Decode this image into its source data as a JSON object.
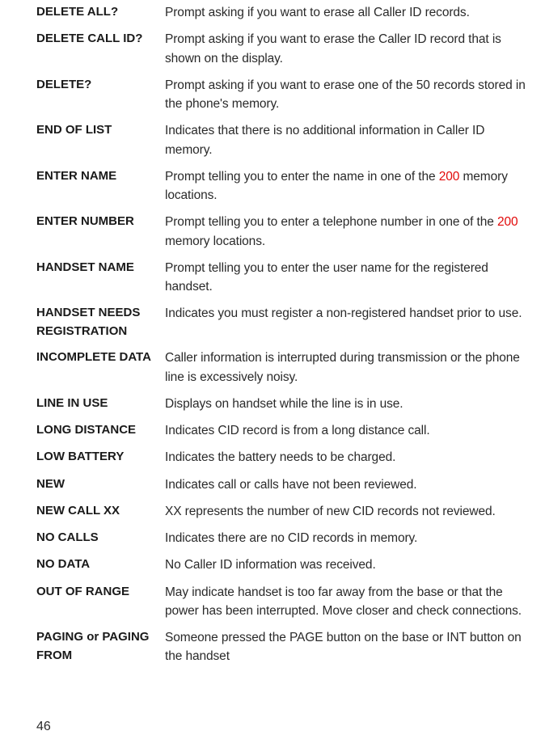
{
  "entries": [
    {
      "term": "DELETE ALL?",
      "parts": [
        {
          "text": "Prompt asking if you want to erase all Caller ID records."
        }
      ]
    },
    {
      "term": "DELETE CALL ID?",
      "parts": [
        {
          "text": "Prompt asking if you want to erase the Caller ID record that is shown on the display."
        }
      ]
    },
    {
      "term": "DELETE?",
      "parts": [
        {
          "text": "Prompt asking if you want to erase one of the 50 records stored in the phone's memory."
        }
      ]
    },
    {
      "term": "END OF LIST",
      "parts": [
        {
          "text": "Indicates that there is no additional information in Caller ID memory."
        }
      ]
    },
    {
      "term": "ENTER NAME",
      "parts": [
        {
          "text": "Prompt telling you to enter the name in one of the "
        },
        {
          "text": "200",
          "red": true
        },
        {
          "text": " memory locations."
        }
      ]
    },
    {
      "term": "ENTER NUMBER",
      "parts": [
        {
          "text": "Prompt telling you to enter a telephone number in one of the "
        },
        {
          "text": "200",
          "red": true
        },
        {
          "text": " memory locations."
        }
      ]
    },
    {
      "term": "HANDSET NAME",
      "parts": [
        {
          "text": "Prompt telling you to enter the user name for the registered handset."
        }
      ]
    },
    {
      "term": "HANDSET NEEDS REGISTRATION",
      "parts": [
        {
          "text": "Indicates you must register a non-registered handset prior to use."
        }
      ]
    },
    {
      "term": "INCOMPLETE DATA",
      "parts": [
        {
          "text": "Caller information is interrupted during transmission or the phone line is excessively noisy."
        }
      ]
    },
    {
      "term": "LINE IN USE",
      "parts": [
        {
          "text": "Displays on handset while the line is in use."
        }
      ]
    },
    {
      "term": "LONG DISTANCE",
      "parts": [
        {
          "text": "Indicates CID record is from a long distance call."
        }
      ]
    },
    {
      "term": "LOW BATTERY",
      "parts": [
        {
          "text": "Indicates the battery needs to be charged."
        }
      ]
    },
    {
      "term": "NEW",
      "parts": [
        {
          "text": "Indicates call or calls have not been reviewed."
        }
      ]
    },
    {
      "term": "NEW CALL XX",
      "parts": [
        {
          "text": "XX represents the number of new CID records not reviewed."
        }
      ]
    },
    {
      "term": "NO CALLS",
      "parts": [
        {
          "text": "Indicates there are no CID records in memory."
        }
      ]
    },
    {
      "term": "NO DATA",
      "parts": [
        {
          "text": "No Caller ID information was received."
        }
      ]
    },
    {
      "term": "OUT OF RANGE",
      "parts": [
        {
          "text": "May indicate handset is too far away from the base or that the power has been interrupted. Move closer and check connections."
        }
      ]
    },
    {
      "term": "PAGING or PAGING FROM",
      "parts": [
        {
          "text": "Someone pressed the PAGE button on the base or INT button on the handset"
        }
      ]
    }
  ],
  "page_number": "46"
}
